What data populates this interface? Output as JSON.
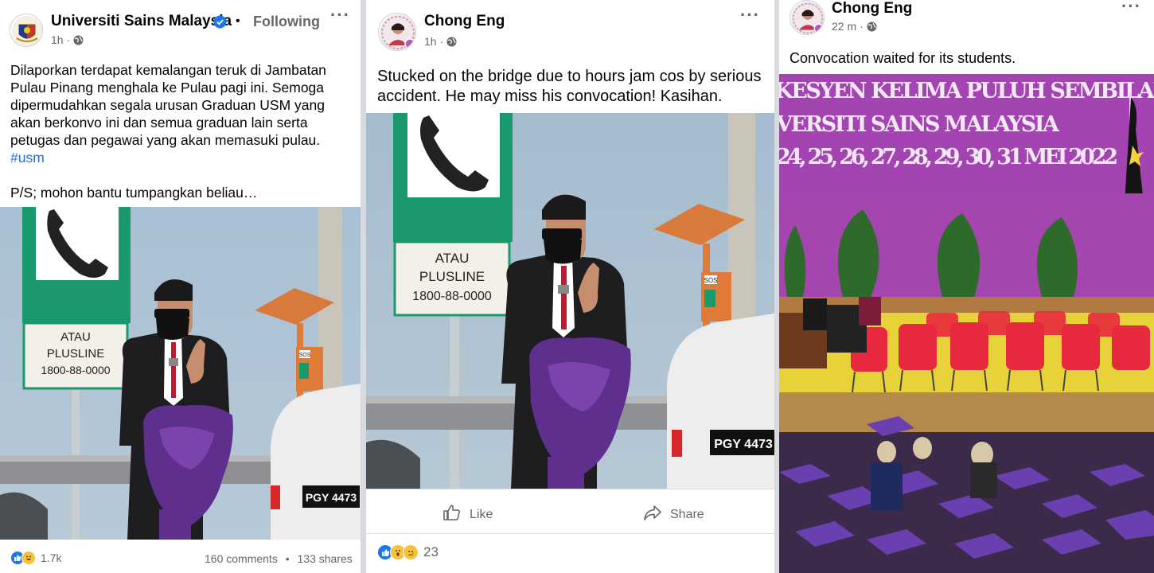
{
  "post1": {
    "page_name": "Universiti Sains Malaysia",
    "verified_icon": "verified-badge-icon",
    "separator": "•",
    "follow_status": "Following",
    "time": "1h",
    "meta_separator": "·",
    "privacy_icon": "globe-icon",
    "menu_icon": "more-options-icon",
    "text_lines": [
      "Dilaporkan terdapat kemalangan teruk di Jambatan",
      "Pulau Pinang menghala ke Pulau pagi ini. Semoga",
      "dipermudahkan segala urusan Graduan USM yang",
      "akan berkonvo ini dan semua graduan lain serta",
      "petugas dan pegawai yang akan memasuki pulau."
    ],
    "hashtag": "#usm",
    "ps_line": "P/S; mohon bantu tumpangkan beliau…",
    "photo": {
      "sign_text_1": "ATAU",
      "sign_text_2": "PLUSLINE",
      "sign_text_3": "1800-88-0000",
      "sos_label": "SOS",
      "plate": "PGY 4473"
    },
    "reaction_count": "1.7k",
    "comments": "160 comments",
    "stats_separator": "•",
    "shares": "133 shares"
  },
  "post2": {
    "author": "Chong Eng",
    "time": "1h",
    "meta_separator": "·",
    "privacy_icon": "globe-icon",
    "menu_icon": "more-options-icon",
    "text_lines": [
      "Stucked on the bridge due to hours jam cos by serious",
      "accident. He may miss his convocation! Kasihan."
    ],
    "photo": {
      "sign_text_1": "ATAU",
      "sign_text_2": "PLUSLINE",
      "sign_text_3": "1800-88-0000",
      "sos_label": "SOS",
      "plate": "PGY 4473"
    },
    "like_label": "Like",
    "share_label": "Share",
    "reaction_count": "23"
  },
  "post3": {
    "author": "Chong Eng",
    "time": "22 m",
    "meta_separator": "·",
    "privacy_icon": "globe-icon",
    "menu_icon": "more-options-icon",
    "text": "Convocation waited for its students.",
    "photo": {
      "banner_line_1": "KESYEN KELIMA PULUH SEMBILAN",
      "banner_line_2": "VERSITI SAINS MALAYSIA",
      "banner_line_3": "24, 25, 26, 27, 28, 29, 30, 31 MEI 2022"
    }
  },
  "colors": {
    "link_blue": "#216fdb",
    "verified_blue": "#1877f2",
    "meta_gray": "#65676b",
    "stage_purple": "#9b3fa8",
    "stage_yellow": "#e8d23a",
    "chair_red": "#e8283e",
    "sign_green": "#1a9a6c"
  }
}
